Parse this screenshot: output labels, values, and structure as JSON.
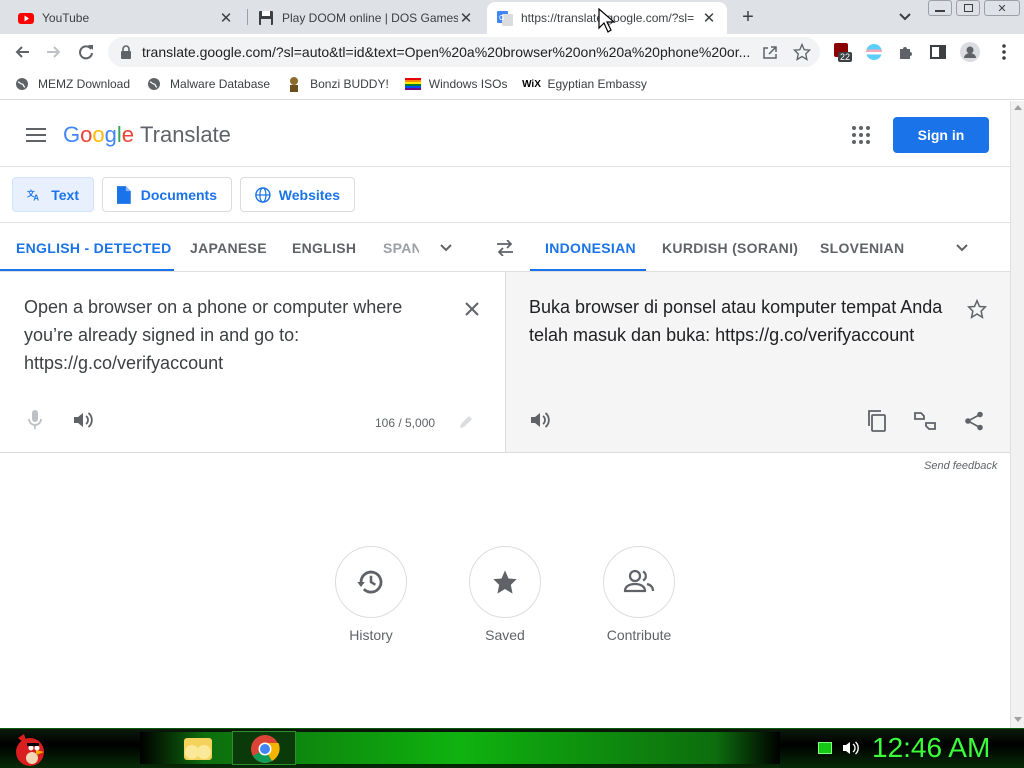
{
  "browser": {
    "tabs": [
      {
        "title": "YouTube",
        "favicon": "youtube-icon"
      },
      {
        "title": "Play DOOM online | DOS Games",
        "favicon": "floppy-disk-icon"
      },
      {
        "title": "https://translate.google.com/?sl=",
        "favicon": "google-translate-icon",
        "active": true
      }
    ],
    "address": "translate.google.com/?sl=auto&tl=id&text=Open%20a%20browser%20on%20a%20phone%20or...",
    "extension_badge": "22",
    "bookmarks": [
      {
        "label": "MEMZ Download",
        "icon": "globe-icon"
      },
      {
        "label": "Malware Database",
        "icon": "globe-icon"
      },
      {
        "label": "Bonzi BUDDY!",
        "icon": "bonzi-icon"
      },
      {
        "label": "Windows ISOs",
        "icon": "rainbow-flag-icon"
      },
      {
        "label": "Egyptian Embassy",
        "icon": "wix-icon"
      }
    ]
  },
  "header": {
    "logo_google": [
      "G",
      "o",
      "o",
      "g",
      "l",
      "e"
    ],
    "logo_colors": [
      "#4285f4",
      "#ea4335",
      "#fbbc05",
      "#4285f4",
      "#34a853",
      "#ea4335"
    ],
    "product": "Translate",
    "sign_in": "Sign in"
  },
  "modes": {
    "text": "Text",
    "documents": "Documents",
    "websites": "Websites"
  },
  "source_langs": [
    "ENGLISH - DETECTED",
    "JAPANESE",
    "ENGLISH",
    "SPAN"
  ],
  "target_langs": [
    "INDONESIAN",
    "KURDISH (SORANI)",
    "SLOVENIAN"
  ],
  "source": {
    "text": "Open a browser on a phone or computer where you’re already signed in and go to: https://g.co/verifyaccount",
    "char_count": "106 / 5,000"
  },
  "target": {
    "text": "Buka browser di ponsel atau komputer tempat Anda telah masuk dan buka: https://g.co/verifyaccount"
  },
  "send_feedback": "Send feedback",
  "shortcuts": [
    {
      "label": "History",
      "icon": "history-icon"
    },
    {
      "label": "Saved",
      "icon": "star-icon"
    },
    {
      "label": "Contribute",
      "icon": "people-icon"
    }
  ],
  "taskbar": {
    "clock": "12:46 AM"
  },
  "colors": {
    "accent": "#1a73e8",
    "taskbar_green": "#3cff3c"
  }
}
